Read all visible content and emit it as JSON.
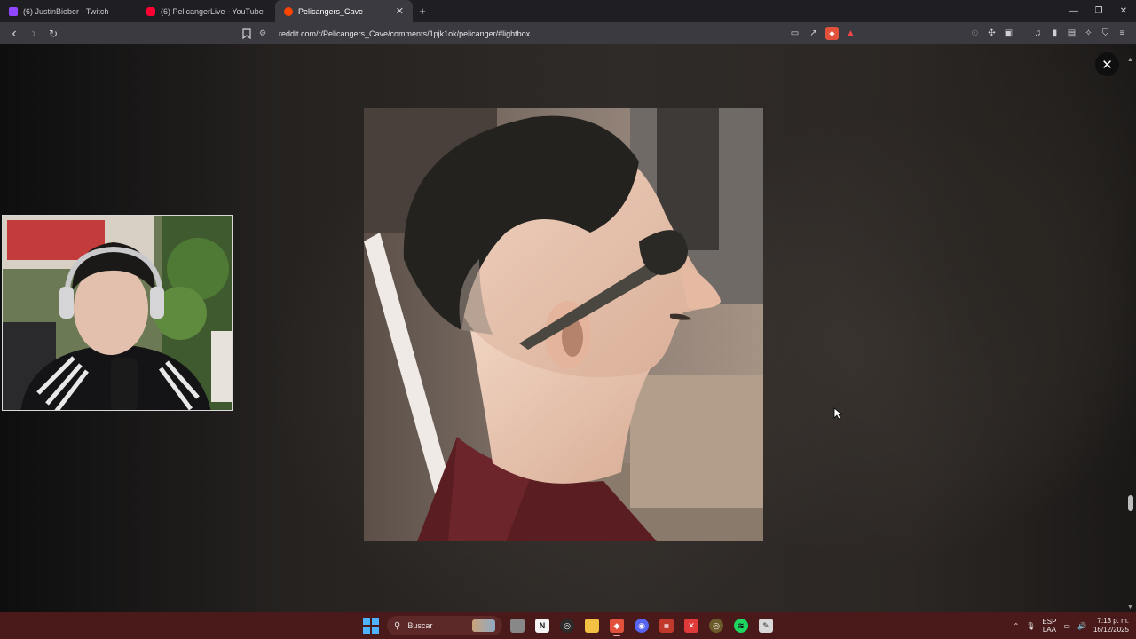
{
  "browser": {
    "tabs": [
      {
        "title": "(6) JustinBieber - Twitch",
        "favicon_color": "#9146ff",
        "active": false
      },
      {
        "title": "(6) PelicangerLive - YouTube",
        "favicon_color": "#ff0033",
        "active": false
      },
      {
        "title": "Pelicangers_Cave",
        "favicon_color": "#ff4500",
        "active": true
      }
    ],
    "new_tab_label": "+",
    "window_controls": {
      "minimize": "—",
      "restore": "❐",
      "close": "✕"
    },
    "toolbar": {
      "back": "‹",
      "forward": "›",
      "reload": "↻",
      "bookmark": "☐",
      "site_info": "⚙",
      "url": "reddit.com/r/Pelicangers_Cave/comments/1pjk1ok/pelicanger/#lightbox"
    }
  },
  "lightbox": {
    "close_label": "✕"
  },
  "taskbar": {
    "search_placeholder": "Buscar",
    "language": {
      "line1": "ESP",
      "line2": "LAA"
    },
    "time": "7:13 p. m.",
    "date": "16/12/2025",
    "accent_color": "#4a1a1a"
  }
}
